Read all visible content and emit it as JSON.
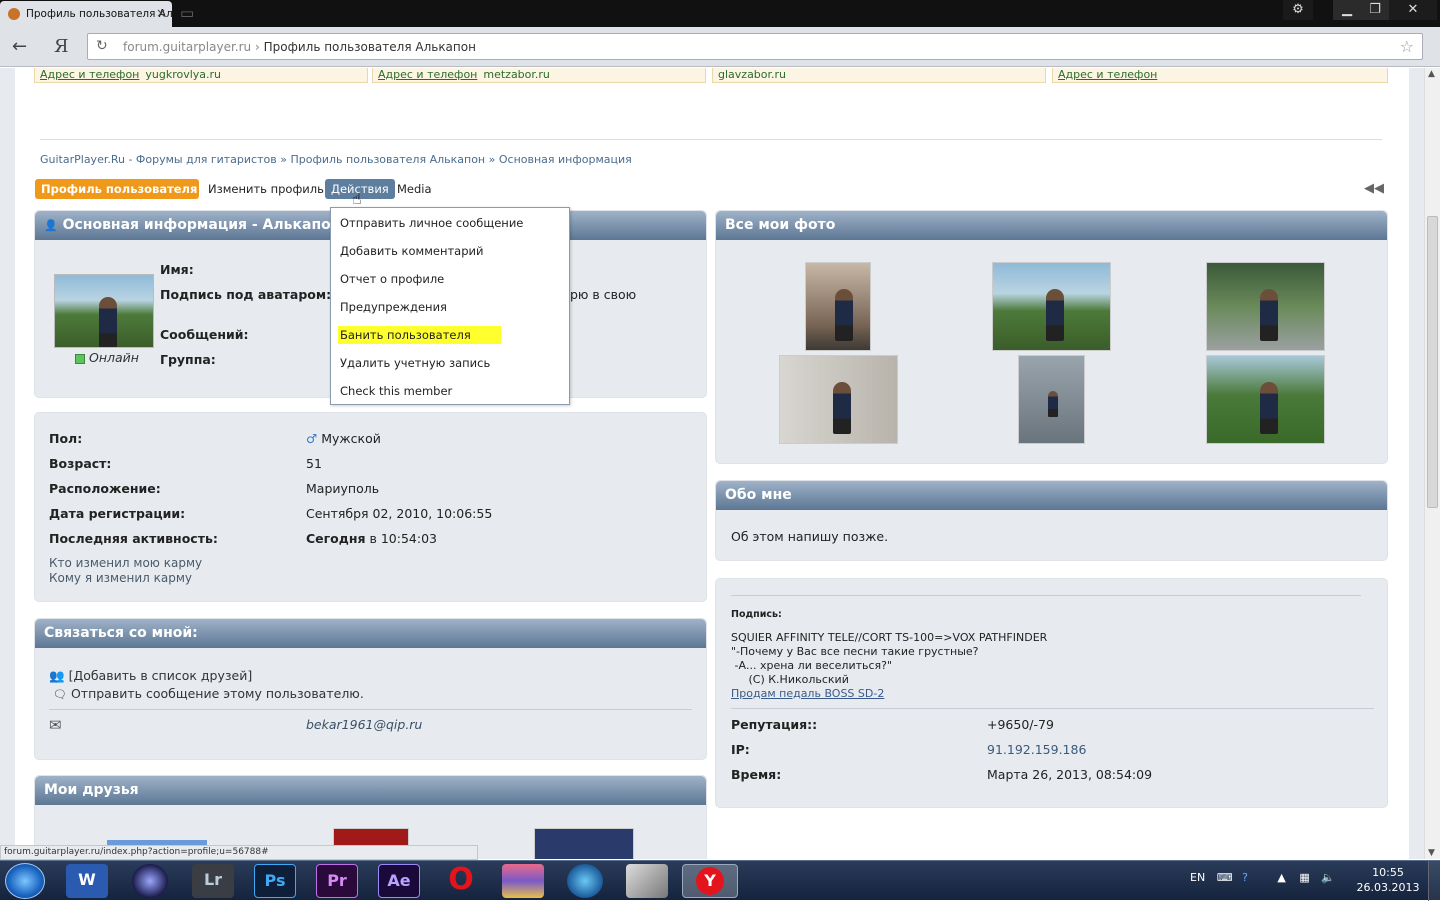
{
  "browser": {
    "tab_title": "Профиль пользователя Ал",
    "url_host": "forum.guitarplayer.ru",
    "url_sep": "›",
    "url_title": "Профиль пользователя Алькапон",
    "yandex_button": "Я"
  },
  "ads": [
    {
      "link": "Адрес и телефон",
      "domain": "yugkrovlya.ru"
    },
    {
      "link": "Адрес и телефон",
      "domain": "metzabor.ru"
    },
    {
      "link": "",
      "domain": "glavzabor.ru"
    },
    {
      "link": "Адрес и телефон",
      "domain": ""
    }
  ],
  "breadcrumb": {
    "home": "GuitarPlayer.Ru - Форумы для гитаристов",
    "sep": "»",
    "profile": "Профиль пользователя Алькапон",
    "current": "Основная информация"
  },
  "profile_tabs": {
    "profile": "Профиль пользователя",
    "edit": "Изменить профиль",
    "actions": "Действия",
    "media": "Media"
  },
  "actions_menu": [
    "Отправить личное сообщение",
    "Добавить комментарий",
    "Отчет о профиле",
    "Предупреждения",
    "Банить пользователя",
    "Удалить учетную запись",
    "Check this member"
  ],
  "basic_info": {
    "title": "Основная информация - Алькапон",
    "online": "Онлайн",
    "name_label": "Имя:",
    "signature_label": "Подпись под аватаром:",
    "signature_tail": "рю в свою",
    "posts_label": "Сообщений:",
    "group_label": "Группа:"
  },
  "details": {
    "gender_label": "Пол:",
    "gender": "Мужской",
    "age_label": "Возраст:",
    "age": "51",
    "location_label": "Расположение:",
    "location": "Мариуполь",
    "registered_label": "Дата регистрации:",
    "registered": "Сентября 02, 2010, 10:06:55",
    "last_active_label": "Последняя активность:",
    "last_active_day": "Сегодня",
    "last_active_time": "в 10:54:03",
    "karma_who": "Кто изменил мою карму",
    "karma_whom": "Кому я изменил карму"
  },
  "contact": {
    "title": "Связаться со мной:",
    "add_friend": "[Добавить в список друзей]",
    "send_message": "Отправить сообщение этому пользователю.",
    "email": "bekar1961@qip.ru"
  },
  "friends": {
    "title": "Мои друзья"
  },
  "photos": {
    "title": "Все мои фото"
  },
  "about": {
    "title": "Обо мне",
    "text": "Об этом напишу позже."
  },
  "signature": {
    "label": "Подпись:",
    "line1": "SQUIER AFFINITY TELE//CORT TS-100=>VOX PATHFINDER",
    "line2": "\"-Почему у Вас все песни такие грустные?",
    "line3": " -А... хрена ли веселиться?\"",
    "line4": "     (С) К.Никольский",
    "link": "Продам педаль BOSS SD-2"
  },
  "stats": {
    "rep_label": "Репутация::",
    "rep": "+9650/-79",
    "ip_label": "IP:",
    "ip": "91.192.159.186",
    "time_label": "Время:",
    "time": "Марта 26, 2013, 08:54:09"
  },
  "status_url": "forum.guitarplayer.ru/index.php?action=profile;u=56788#",
  "taskbar": {
    "apps": [
      "W",
      "",
      "Lr",
      "Ps",
      "Pr",
      "Ae",
      "",
      "",
      "",
      "",
      ""
    ],
    "lang": "EN",
    "time": "10:55",
    "date": "26.03.2013"
  },
  "colors": {
    "accent_orange": "#f0981a",
    "panel_head": "#5c7794",
    "link_blue": "#4a6c8e",
    "highlight": "#ffff2e"
  }
}
